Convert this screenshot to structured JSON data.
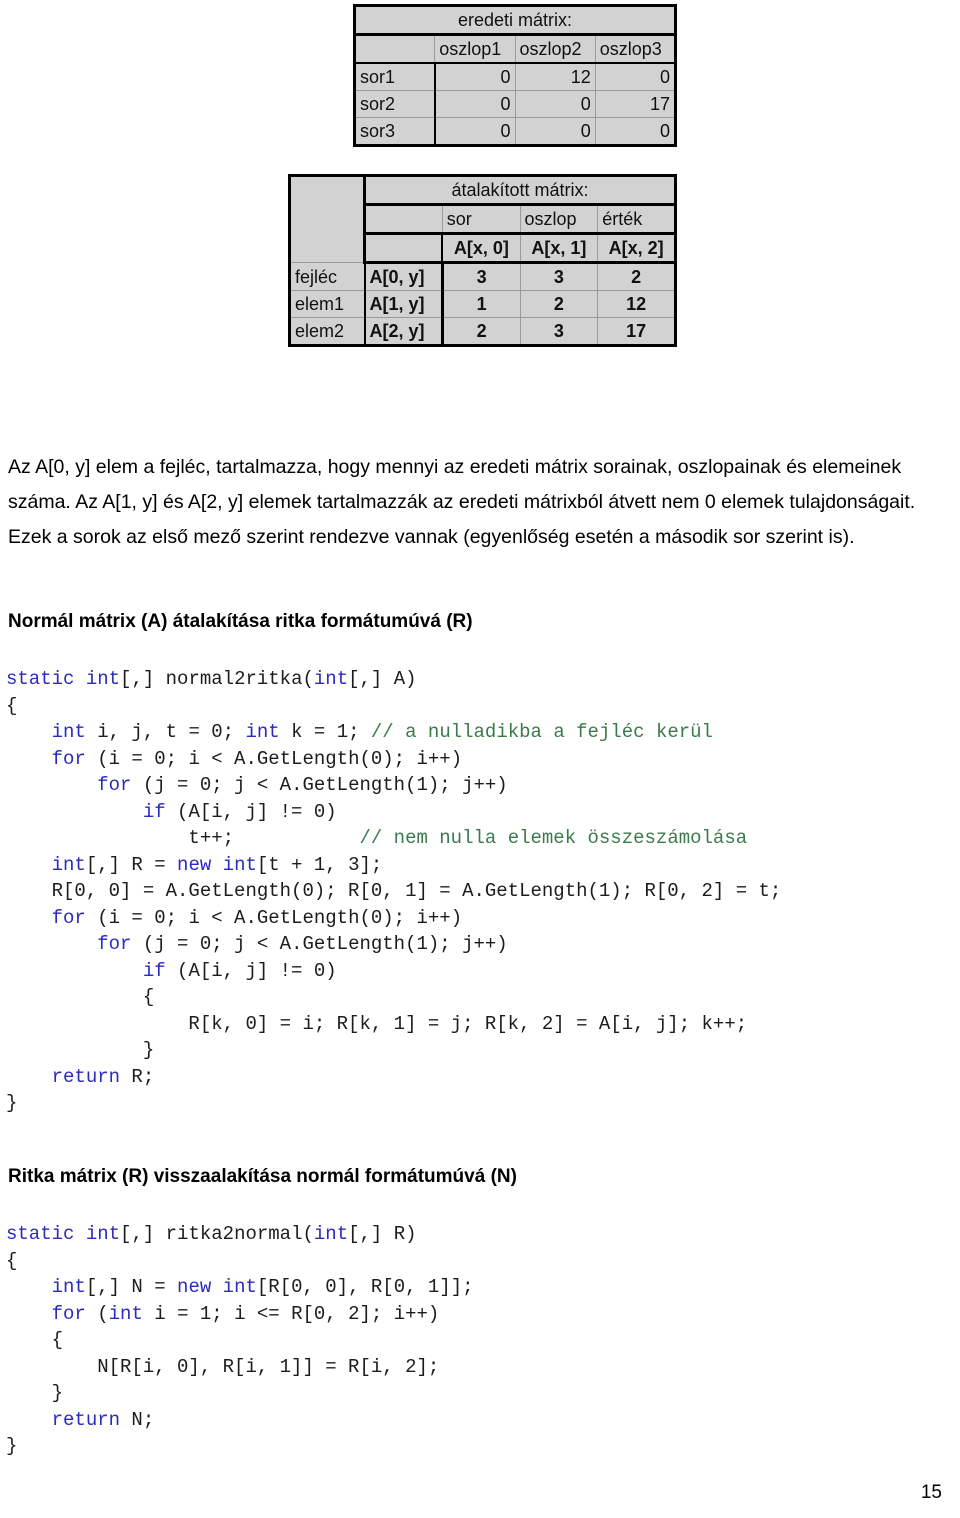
{
  "figure": {
    "table_original": {
      "title": "eredeti mátrix:",
      "column_headers": [
        "",
        "oszlop1",
        "oszlop2",
        "oszlop3"
      ],
      "rows": [
        {
          "label": "sor1",
          "values": [
            "0",
            "12",
            "0"
          ]
        },
        {
          "label": "sor2",
          "values": [
            "0",
            "0",
            "17"
          ]
        },
        {
          "label": "sor3",
          "values": [
            "0",
            "0",
            "0"
          ]
        }
      ]
    },
    "table_converted": {
      "title": "átalakított mátrix:",
      "group_headers": [
        "sor",
        "oszlop",
        "érték"
      ],
      "index_headers": [
        "A[x, 0]",
        "A[x, 1]",
        "A[x, 2]"
      ],
      "rows": [
        {
          "name": "fejléc",
          "ref": "A[0, y]",
          "values": [
            "3",
            "3",
            "2"
          ]
        },
        {
          "name": "elem1",
          "ref": "A[1, y]",
          "values": [
            "1",
            "2",
            "12"
          ]
        },
        {
          "name": "elem2",
          "ref": "A[2, y]",
          "values": [
            "2",
            "3",
            "17"
          ]
        }
      ]
    }
  },
  "body": {
    "paragraph_1": "Az A[0, y] elem a fejléc, tartalmazza, hogy mennyi az eredeti mátrix sorainak, oszlopainak és elemeinek száma. Az A[1, y] és A[2, y] elemek tartalmazzák az eredeti mátrixból átvett nem 0 elemek tulajdonságait. Ezek a sorok az első mező szerint rendezve vannak (egyenlőség esetén a második sor szerint is).",
    "heading_1": "Normál mátrix (A) átalakítása ritka formátumúvá (R)",
    "heading_2": "Ritka mátrix (R) visszaalakítása normál formátumúvá (N)"
  },
  "code_blocks": {
    "normal2ritka": {
      "lines": [
        [
          {
            "t": "static",
            "c": "kw"
          },
          {
            "t": " "
          },
          {
            "t": "int",
            "c": "kw"
          },
          {
            "t": "[,] normal2ritka("
          },
          {
            "t": "int",
            "c": "kw"
          },
          {
            "t": "[,] A)"
          }
        ],
        [
          {
            "t": "{"
          }
        ],
        [
          {
            "t": "    "
          },
          {
            "t": "int",
            "c": "kw"
          },
          {
            "t": " i, j, t = 0; "
          },
          {
            "t": "int",
            "c": "kw"
          },
          {
            "t": " k = 1; "
          },
          {
            "t": "// a nulladikba a fejléc kerül",
            "c": "cmt"
          }
        ],
        [
          {
            "t": "    "
          },
          {
            "t": "for",
            "c": "kw"
          },
          {
            "t": " (i = 0; i < A.GetLength(0); i++)"
          }
        ],
        [
          {
            "t": "        "
          },
          {
            "t": "for",
            "c": "kw"
          },
          {
            "t": " (j = 0; j < A.GetLength(1); j++)"
          }
        ],
        [
          {
            "t": "            "
          },
          {
            "t": "if",
            "c": "kw"
          },
          {
            "t": " (A[i, j] != 0)"
          }
        ],
        [
          {
            "t": "                t++;           "
          },
          {
            "t": "// nem nulla elemek összeszámolása",
            "c": "cmt"
          }
        ],
        [
          {
            "t": "    "
          },
          {
            "t": "int",
            "c": "kw"
          },
          {
            "t": "[,] R = "
          },
          {
            "t": "new",
            "c": "kw"
          },
          {
            "t": " "
          },
          {
            "t": "int",
            "c": "kw"
          },
          {
            "t": "[t + 1, 3];"
          }
        ],
        [
          {
            "t": "    R[0, 0] = A.GetLength(0); R[0, 1] = A.GetLength(1); R[0, 2] = t;"
          }
        ],
        [
          {
            "t": "    "
          },
          {
            "t": "for",
            "c": "kw"
          },
          {
            "t": " (i = 0; i < A.GetLength(0); i++)"
          }
        ],
        [
          {
            "t": "        "
          },
          {
            "t": "for",
            "c": "kw"
          },
          {
            "t": " (j = 0; j < A.GetLength(1); j++)"
          }
        ],
        [
          {
            "t": "            "
          },
          {
            "t": "if",
            "c": "kw"
          },
          {
            "t": " (A[i, j] != 0)"
          }
        ],
        [
          {
            "t": "            {"
          }
        ],
        [
          {
            "t": "                R[k, 0] = i; R[k, 1] = j; R[k, 2] = A[i, j]; k++;"
          }
        ],
        [
          {
            "t": "            }"
          }
        ],
        [
          {
            "t": "    "
          },
          {
            "t": "return",
            "c": "kw"
          },
          {
            "t": " R;"
          }
        ],
        [
          {
            "t": "}"
          }
        ]
      ]
    },
    "ritka2normal": {
      "lines": [
        [
          {
            "t": "static",
            "c": "kw"
          },
          {
            "t": " "
          },
          {
            "t": "int",
            "c": "kw"
          },
          {
            "t": "[,] ritka2normal("
          },
          {
            "t": "int",
            "c": "kw"
          },
          {
            "t": "[,] R)"
          }
        ],
        [
          {
            "t": "{"
          }
        ],
        [
          {
            "t": "    "
          },
          {
            "t": "int",
            "c": "kw"
          },
          {
            "t": "[,] N = "
          },
          {
            "t": "new",
            "c": "kw"
          },
          {
            "t": " "
          },
          {
            "t": "int",
            "c": "kw"
          },
          {
            "t": "[R[0, 0], R[0, 1]];"
          }
        ],
        [
          {
            "t": "    "
          },
          {
            "t": "for",
            "c": "kw"
          },
          {
            "t": " ("
          },
          {
            "t": "int",
            "c": "kw"
          },
          {
            "t": " i = 1; i <= R[0, 2]; i++)"
          }
        ],
        [
          {
            "t": "    {"
          }
        ],
        [
          {
            "t": "        N[R[i, 0], R[i, 1]] = R[i, 2];"
          }
        ],
        [
          {
            "t": "    }"
          }
        ],
        [
          {
            "t": "    "
          },
          {
            "t": "return",
            "c": "kw"
          },
          {
            "t": " N;"
          }
        ],
        [
          {
            "t": "}"
          }
        ]
      ]
    }
  },
  "footer": {
    "page_number": "15"
  },
  "colors": {
    "keyword": "#2b2bbd",
    "comment": "#3d7a4a",
    "table_fill": "#d2d2d2",
    "table_border": "#000000"
  }
}
